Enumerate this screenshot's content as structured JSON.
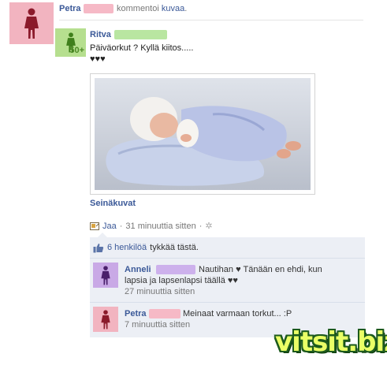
{
  "story": {
    "author": "Petra",
    "action_text": "kommentoi",
    "object_link": "kuvaa",
    "trailing": "."
  },
  "post": {
    "author": "Ritva",
    "age_badge": "50+",
    "text_line1": "Päiväorkut ? Kyllä kiitos.....",
    "text_line2": "♥♥♥",
    "album_link": "Seinäkuvat"
  },
  "actions": {
    "share": "Jaa",
    "separator": "·",
    "time": "31 minuuttia sitten",
    "separator2": "·"
  },
  "likes": {
    "count_link": "6 henkilöä",
    "suffix": "tykkää tästä."
  },
  "comments": [
    {
      "author": "Anneli",
      "text_line1": "Nautihan ♥ Tänään en ehdi, kun",
      "text_line2": "lapsia ja lapsenlapsi täällä ♥♥",
      "time": "27 minuuttia sitten"
    },
    {
      "author": "Petra",
      "text_line1": "Meinaat varmaan torkut... :P",
      "time": "7 minuuttia sitten"
    }
  ],
  "watermark": "vitsit.biz",
  "colors": {
    "link": "#3b5998",
    "avatar_pink": "#f2b4c0",
    "avatar_green": "#b6df8f",
    "avatar_purple": "#c9a9e6",
    "comments_bg": "#eceff5"
  },
  "icons": [
    "female-silhouette-icon",
    "share-icon",
    "gear-icon",
    "thumbs-up-icon"
  ]
}
